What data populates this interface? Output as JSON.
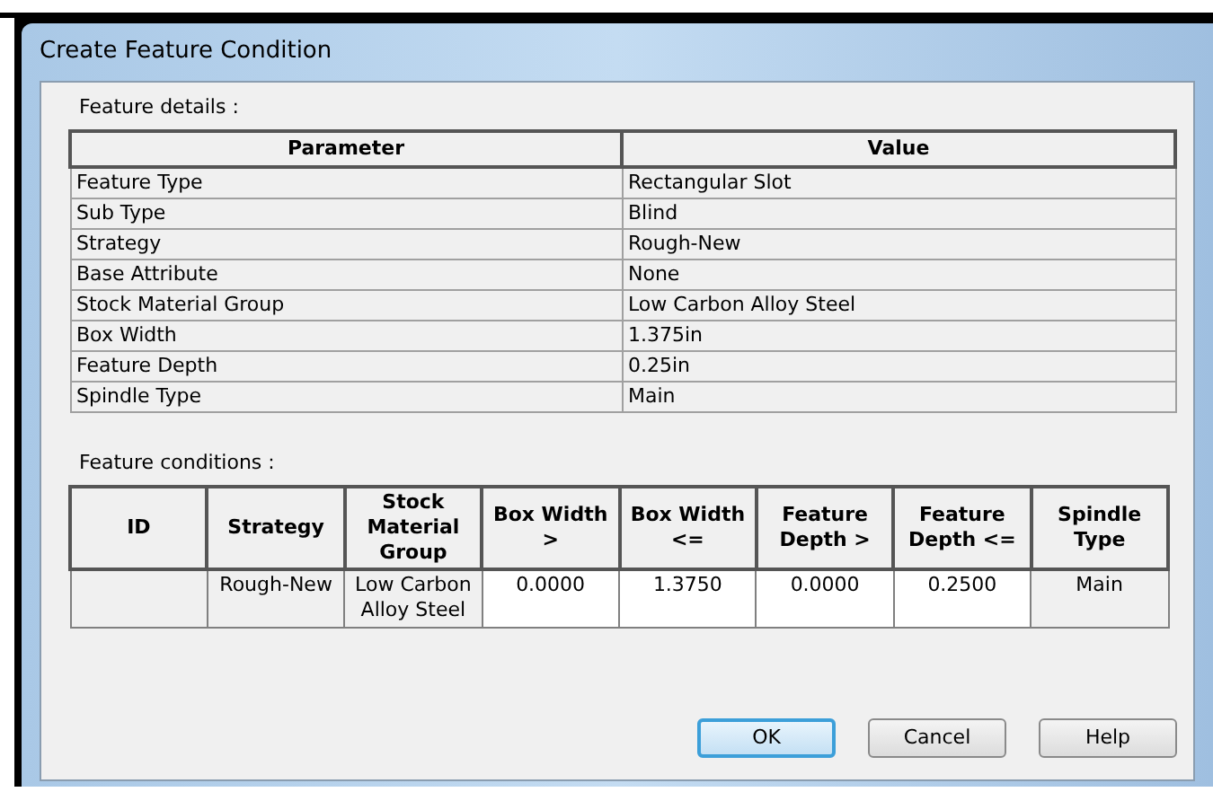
{
  "window": {
    "title": "Create Feature Condition"
  },
  "details": {
    "label": "Feature details :",
    "columns": [
      "Parameter",
      "Value"
    ],
    "rows": [
      [
        "Feature Type",
        "Rectangular Slot"
      ],
      [
        "Sub Type",
        "Blind"
      ],
      [
        "Strategy",
        "Rough-New"
      ],
      [
        "Base Attribute",
        "None"
      ],
      [
        "Stock Material Group",
        "Low Carbon Alloy Steel"
      ],
      [
        "Box Width",
        "1.375in"
      ],
      [
        "Feature Depth",
        "0.25in"
      ],
      [
        "Spindle Type",
        "Main"
      ]
    ]
  },
  "conditions": {
    "label": "Feature conditions :",
    "columns": [
      "ID",
      "Strategy",
      "Stock Material Group",
      "Box Width >",
      "Box Width <=",
      "Feature Depth >",
      "Feature Depth <=",
      "Spindle Type"
    ],
    "rows": [
      [
        {
          "editable": false
        },
        {
          "text": "Rough-New",
          "editable": false
        },
        {
          "text": "Low Carbon Alloy Steel",
          "editable": false
        },
        {
          "text": "0.0000",
          "editable": true
        },
        {
          "text": "1.3750",
          "editable": true
        },
        {
          "text": "0.0000",
          "editable": true
        },
        {
          "text": "0.2500",
          "editable": true
        },
        {
          "text": "Main",
          "editable": false
        }
      ]
    ]
  },
  "buttons": [
    {
      "label": "OK",
      "default": true
    },
    {
      "label": "Cancel",
      "default": false
    },
    {
      "label": "Help",
      "default": false
    }
  ]
}
